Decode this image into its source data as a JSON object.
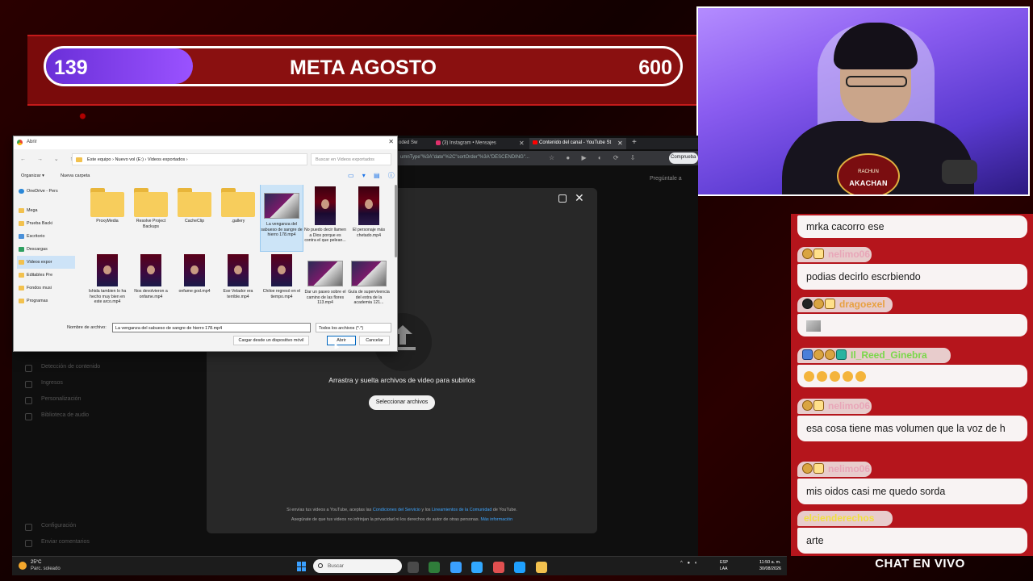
{
  "goal": {
    "current": "139",
    "title": "META AGOSTO",
    "target": "600",
    "progress": 0.232,
    "fill_color": "#7b3ce6"
  },
  "webcam": {
    "logo_text": "AKACHAN",
    "logo_top": "RACHUN"
  },
  "browser": {
    "tabs": [
      {
        "label": "oded Sw"
      },
      {
        "label": "(3) Instagram • Mensajes"
      },
      {
        "label": "Contenido del canal - YouTube St"
      }
    ],
    "address": "umnType\"%3A\"date\"%2C\"sortOrder\"%3A\"DESCENDING\"...",
    "compare_label": "Comprueba",
    "studio_topbar": "Pregúntale a"
  },
  "studio_sidebar": {
    "items": [
      {
        "label": "Detección de contenido"
      },
      {
        "label": "Ingresos"
      },
      {
        "label": "Personalización"
      },
      {
        "label": "Biblioteca de audio"
      }
    ],
    "bottom": [
      {
        "label": "Configuración"
      },
      {
        "label": "Enviar comentarios"
      }
    ]
  },
  "upload_dialog": {
    "drag_text": "Arrastra y suelta archivos de video para subirlos",
    "select_button": "Seleccionar archivos",
    "terms_prefix": "Si envías tus videos a YouTube, aceptas las ",
    "terms_link_1": "Condiciones del Servicio",
    "terms_middle": " y los ",
    "terms_link_2": "Lineamientos de la Comunidad",
    "terms_suffix": " de YouTube.",
    "privacy_prefix": "Asegúrate de que tus videos no infrinjan la privacidad ni los derechos de autor de otras personas. ",
    "privacy_link": "Más información"
  },
  "file_dialog": {
    "title": "Abrir",
    "breadcrumb": "Este equipo  ›  Nuevo vol (E:)  ›  Videos exportados  ›",
    "search_placeholder": "Buscar en Videos exportados",
    "organize": "Organizar ▾",
    "new_folder": "Nueva carpeta",
    "nav_items": [
      {
        "label": "OneDrive - Pers",
        "kind": "cloud"
      },
      {
        "label": "Mega",
        "kind": "folder"
      },
      {
        "label": "Prueba Backi",
        "kind": "folder"
      },
      {
        "label": "Escritorio",
        "kind": "blue"
      },
      {
        "label": "Descargas",
        "kind": "green"
      },
      {
        "label": "Videos expor",
        "kind": "folder",
        "selected": true
      },
      {
        "label": "Editables Pre",
        "kind": "folder"
      },
      {
        "label": "Fondos musi",
        "kind": "folder"
      },
      {
        "label": "Programas",
        "kind": "folder"
      }
    ],
    "files": [
      {
        "name": "ProxyMedia",
        "type": "folder"
      },
      {
        "name": "Resolve Project Backups",
        "type": "folder"
      },
      {
        "name": "CacheClip",
        "type": "folder"
      },
      {
        "name": ".gallery",
        "type": "folder"
      },
      {
        "name": "La venganza del sabueso de sangre de hierro 178.mp4",
        "type": "wide",
        "selected": true
      },
      {
        "name": "No puedo decir llamen a Dios porque es contra el que pelean...",
        "type": "video"
      },
      {
        "name": "El personaje más chetado.mp4",
        "type": "video"
      },
      {
        "name": "Ishida tambien lo ha hecho muy bien en este arco.mp4",
        "type": "video"
      },
      {
        "name": "Nos devolvieron a onfame.mp4",
        "type": "video"
      },
      {
        "name": "onfame god.mp4",
        "type": "video"
      },
      {
        "name": "Ese Velador era terrible.mp4",
        "type": "video"
      },
      {
        "name": "Chiloe regresó en el tiempo.mp4",
        "type": "video"
      },
      {
        "name": "Dar un paseo sobre el camino de las flores 113.mp4",
        "type": "wide"
      },
      {
        "name": "Guía de supervivencia del extra de la academia 121...",
        "type": "wide"
      }
    ],
    "filename_label": "Nombre de archivo:",
    "filename_value": "La venganza del sabueso de sangre de hierro 178.mp4",
    "filetype_value": "Todos los archivos (*.*)",
    "mobile_button": "Cargar desde un dispositivo móvil",
    "open_button": "Abrir",
    "cancel_button": "Cancelar"
  },
  "taskbar": {
    "weather_temp": "25°C",
    "weather_desc": "Parc. soleado",
    "search_placeholder": "Buscar",
    "lang_1": "ESP",
    "lang_2": "LAA",
    "time": "11:50 a. m.",
    "date": "30/08/2026",
    "app_colors": [
      "#4a4a4a",
      "#2f7d3a",
      "#3aa0ff",
      "#31a8ff",
      "#e05050",
      "#1fa1ff",
      "#f2c14e"
    ]
  },
  "chat": {
    "messages": [
      {
        "user": "",
        "text": "mrka cacorro ese",
        "badges": []
      },
      {
        "user": "nelimo06",
        "text": "podias decirlo escrbiendo",
        "badges": [
          "round",
          "sq"
        ]
      },
      {
        "user": "dragoexel",
        "text": "",
        "badges": [
          "eye",
          "round",
          "sq"
        ],
        "image": true
      },
      {
        "user": "Il_Reed_Ginebra",
        "text": "",
        "badges": [
          "blue",
          "round",
          "round",
          "teal"
        ],
        "emotes": 5
      },
      {
        "user": "nelimo06",
        "text": "esa cosa tiene mas volumen que la voz de h",
        "badges": [
          "round",
          "sq"
        ]
      },
      {
        "user": "nelimo06",
        "text": "mis oidos casi me quedo sorda",
        "badges": [
          "round",
          "sq"
        ]
      },
      {
        "user": "elcienderechos",
        "text": "arte",
        "badges": []
      }
    ],
    "footer": "CHAT EN VIVO"
  }
}
